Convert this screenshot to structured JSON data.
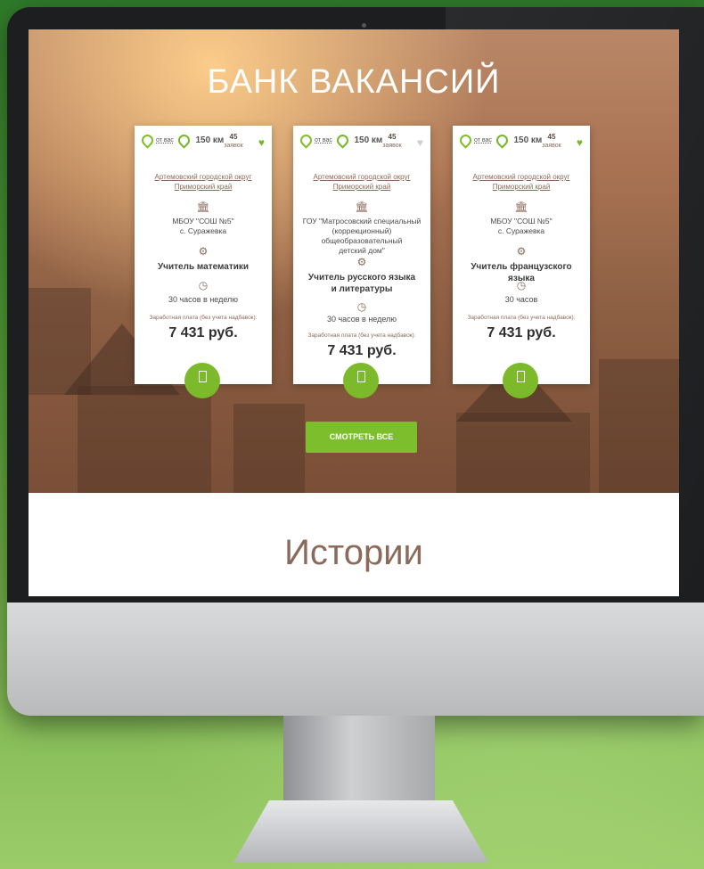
{
  "hero": {
    "title": "БАНК ВАКАНСИЙ",
    "view_all_label": "СМОТРЕТЬ ВСЕ"
  },
  "cards": [
    {
      "from_you": "от вас",
      "distance": "150 км",
      "requests_count": "45",
      "requests_label": "заявок",
      "favorite": true,
      "region_line1": "Артемовский городской округ",
      "region_line2": "Приморский край",
      "school_line1": "МБОУ \"СОШ №5\"",
      "school_line2": "с. Суражевка",
      "school_line3": "",
      "position_line1": "Учитель математики",
      "position_line2": "",
      "hours": "30 часов в неделю",
      "salary_label": "Заработная плата (без учета надбавок):",
      "salary": "7 431 руб."
    },
    {
      "from_you": "от вас",
      "distance": "150 км",
      "requests_count": "45",
      "requests_label": "заявок",
      "favorite": false,
      "region_line1": "Артемовский городской округ",
      "region_line2": "Приморский край",
      "school_line1": "ГОУ \"Матросовский специальный",
      "school_line2": "(коррекционный) общеобразовательный",
      "school_line3": "детский дом\"",
      "position_line1": "Учитель русского языка",
      "position_line2": "и литературы",
      "hours": "30 часов в неделю",
      "salary_label": "Заработная плата (без учета надбавок):",
      "salary": "7 431 руб."
    },
    {
      "from_you": "от вас",
      "distance": "150 км",
      "requests_count": "45",
      "requests_label": "заявок",
      "favorite": true,
      "region_line1": "Артемовский городской округ",
      "region_line2": "Приморский край",
      "school_line1": "МБОУ \"СОШ №5\"",
      "school_line2": "с. Суражевка",
      "school_line3": "",
      "position_line1": "Учитель французского языка",
      "position_line2": "",
      "hours": "30 часов",
      "salary_label": "Заработная плата (без учета надбавок):",
      "salary": "7 431 руб."
    }
  ],
  "stories": {
    "title": "Истории"
  },
  "icons": {
    "location": "map-pin-icon",
    "favorite": "heart-icon",
    "school": "building-icon",
    "position": "gear-icon",
    "hours": "clock-icon",
    "apply": "document-icon"
  },
  "colors": {
    "accent_green": "#7cbe2c",
    "brown_text": "#8b6a5a"
  }
}
